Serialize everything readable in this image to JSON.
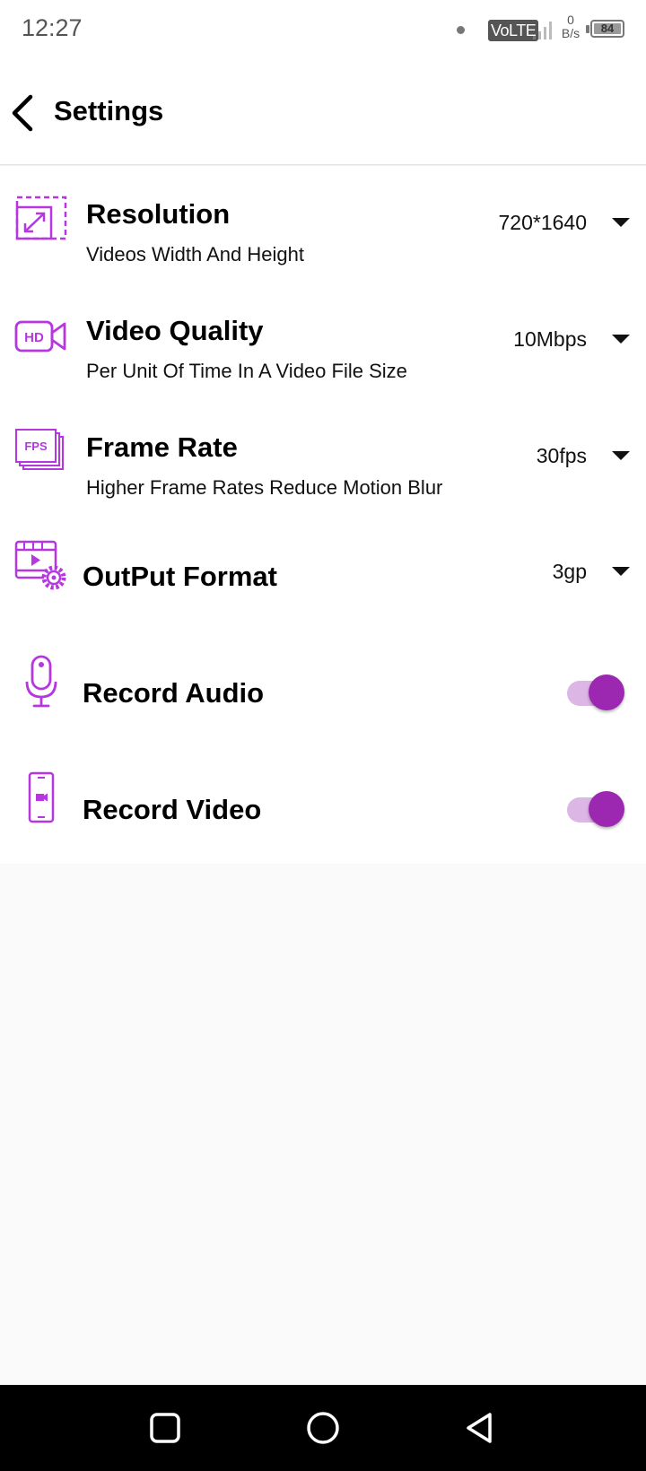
{
  "status_bar": {
    "time": "12:27",
    "network": "VoLTE",
    "speed_value": "0",
    "speed_unit": "B/s",
    "battery": "84"
  },
  "header": {
    "title": "Settings",
    "back_icon": "back-arrow-icon"
  },
  "settings": {
    "resolution": {
      "icon": "resize-icon",
      "title": "Resolution",
      "subtitle": "Videos Width And Height",
      "value": "720*1640"
    },
    "video_quality": {
      "icon": "hd-camera-icon",
      "title": "Video Quality",
      "subtitle": "Per Unit Of Time In A Video File Size",
      "value": "10Mbps"
    },
    "frame_rate": {
      "icon": "fps-icon",
      "title": "Frame Rate",
      "subtitle": "Higher Frame Rates Reduce Motion Blur",
      "value": "30fps"
    },
    "output_format": {
      "icon": "video-gear-icon",
      "title": "OutPut Format",
      "value": "3gp"
    },
    "record_audio": {
      "icon": "microphone-icon",
      "title": "Record Audio",
      "enabled": true
    },
    "record_video": {
      "icon": "phone-camera-icon",
      "title": "Record Video",
      "enabled": true
    }
  },
  "nav_bar": {
    "icons": [
      "recents-square-icon",
      "home-circle-icon",
      "back-triangle-icon"
    ]
  },
  "colors": {
    "accent": "#b636e0",
    "switch_thumb": "#9c27b0",
    "switch_track": "#dcb6e4",
    "text": "#000000",
    "background": "#fafafa"
  }
}
